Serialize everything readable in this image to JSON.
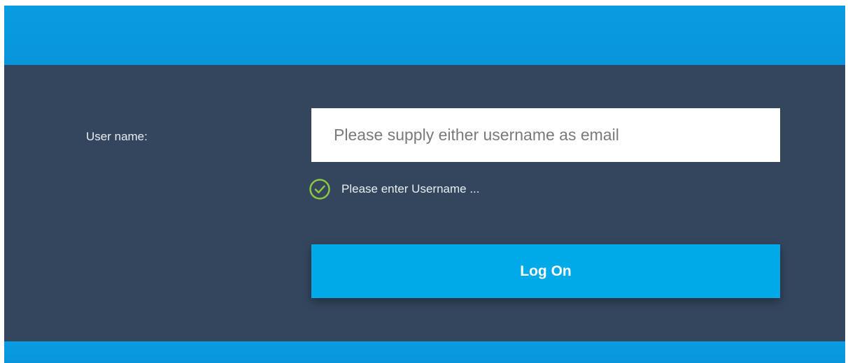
{
  "login": {
    "username_label": "User name:",
    "username_placeholder": "Please supply either username as email",
    "username_value": "",
    "validation_message": "Please enter Username ...",
    "logon_label": "Log On"
  },
  "icons": {
    "validation": "check-circle-icon"
  },
  "colors": {
    "header_blue": "#0795db",
    "panel_background": "#34465e",
    "button_blue": "#00aae9",
    "check_green": "#8dc63f"
  }
}
